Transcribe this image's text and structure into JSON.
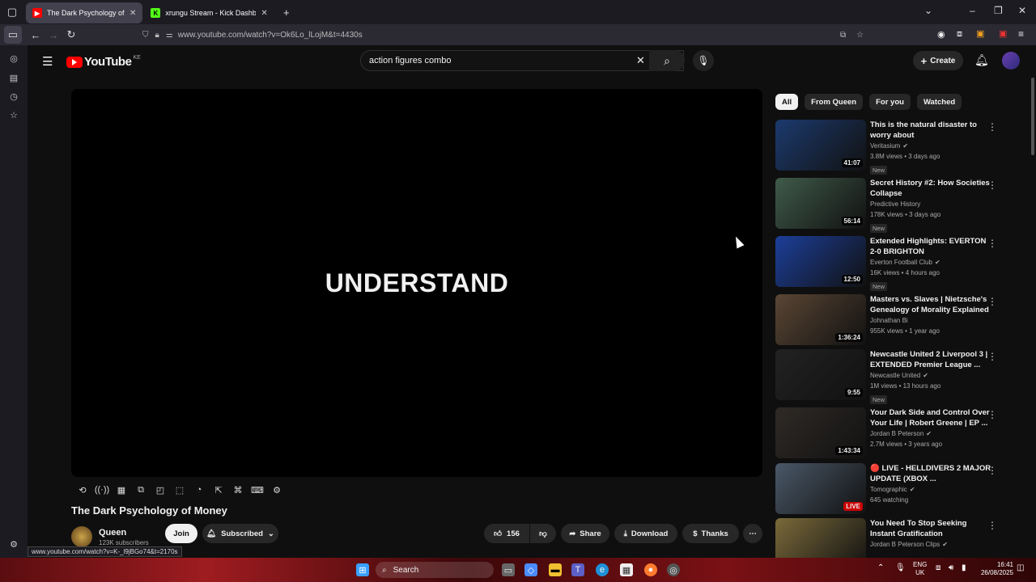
{
  "browser": {
    "tabs": [
      {
        "label": "The Dark Psychology of M",
        "active": true
      },
      {
        "label": "xrungu Stream - Kick Dashboar",
        "active": false
      }
    ],
    "url": "www.youtube.com/watch?v=Ok6Lo_lLojM&t=4430s",
    "status_url": "www.youtube.com/watch?v=K-_l9jBGo74&t=2170s"
  },
  "masthead": {
    "logo_text": "YouTube",
    "country_code": "KE",
    "search_value": "action figures combo",
    "create_label": "Create"
  },
  "player": {
    "caption": "UNDERSTAND"
  },
  "video": {
    "title": "The Dark Psychology of Money",
    "channel": "Queen",
    "subscribers": "123K subscribers",
    "join_label": "Join",
    "subscribed_label": "Subscribed",
    "likes": "156",
    "share_label": "Share",
    "download_label": "Download",
    "thanks_label": "Thanks"
  },
  "chips": [
    {
      "label": "All",
      "selected": true
    },
    {
      "label": "From Queen",
      "selected": false
    },
    {
      "label": "For you",
      "selected": false
    },
    {
      "label": "Watched",
      "selected": false
    }
  ],
  "recommendations": [
    {
      "title": "This is the natural disaster to worry about",
      "channel": "Veritasium",
      "verified": true,
      "meta": "3.8M views • 3 days ago",
      "duration": "41:07",
      "badge": "New",
      "thumb_color": "#1c3a6e"
    },
    {
      "title": "Secret History #2: How Societies Collapse",
      "channel": "Predictive History",
      "verified": false,
      "meta": "178K views • 3 days ago",
      "duration": "56:14",
      "badge": "New",
      "thumb_color": "#3f5a4a"
    },
    {
      "title": "Extended Highlights: EVERTON 2-0 BRIGHTON",
      "channel": "Everton Football Club",
      "verified": true,
      "meta": "16K views • 4 hours ago",
      "duration": "12:50",
      "badge": "New",
      "thumb_color": "#1d3f9a"
    },
    {
      "title": "Masters vs. Slaves | Nietzsche's Genealogy of Morality Explained",
      "channel": "Johnathan Bi",
      "verified": false,
      "meta": "955K views • 1 year ago",
      "duration": "1:36:24",
      "badge": "",
      "thumb_color": "#5a4634"
    },
    {
      "title": "Newcastle United 2 Liverpool 3 | EXTENDED Premier League ...",
      "channel": "Newcastle United",
      "verified": true,
      "meta": "1M views • 13 hours ago",
      "duration": "9:55",
      "badge": "New",
      "thumb_color": "#222"
    },
    {
      "title": "Your Dark Side and Control Over Your Life | Robert Greene | EP ...",
      "channel": "Jordan B Peterson",
      "verified": true,
      "meta": "2.7M views • 3 years ago",
      "duration": "1:43:34",
      "badge": "",
      "thumb_color": "#2f2a26"
    },
    {
      "title": "🔴 LIVE - HELLDIVERS 2 MAJOR UPDATE (XBOX ...",
      "channel": "Tomographic",
      "verified": true,
      "meta": "645 watching",
      "duration": "LIVE",
      "badge": "",
      "thumb_color": "#4a5868"
    },
    {
      "title": "You Need To Stop Seeking Instant Gratification",
      "channel": "Jordan B Peterson Clips",
      "verified": true,
      "meta": "",
      "duration": "",
      "badge": "",
      "thumb_color": "#7a6a3a"
    }
  ],
  "taskbar": {
    "search_label": "Search",
    "lang": "ENG",
    "region": "UK",
    "time": "16:41",
    "date": "26/08/2025"
  },
  "colors": {
    "accent": "#ff0000",
    "background": "#0f0f0f"
  }
}
